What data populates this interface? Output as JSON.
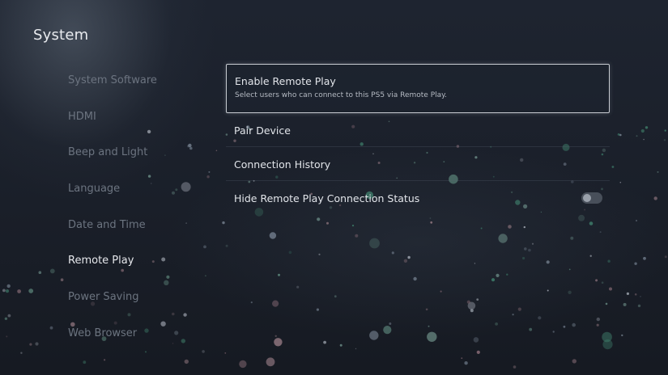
{
  "header": {
    "title": "System"
  },
  "sidebar": {
    "items": [
      {
        "label": "System Software",
        "selected": false
      },
      {
        "label": "HDMI",
        "selected": false
      },
      {
        "label": "Beep and Light",
        "selected": false
      },
      {
        "label": "Language",
        "selected": false
      },
      {
        "label": "Date and Time",
        "selected": false
      },
      {
        "label": "Remote Play",
        "selected": true
      },
      {
        "label": "Power Saving",
        "selected": false
      },
      {
        "label": "Web Browser",
        "selected": false
      }
    ]
  },
  "remote_play": {
    "enable": {
      "label": "Enable Remote Play",
      "description": "Select users who can connect to this PS5 via Remote Play."
    },
    "pair_device": {
      "label": "Pair Device"
    },
    "connection_history": {
      "label": "Connection History"
    },
    "hide_status": {
      "label": "Hide Remote Play Connection Status",
      "toggle_on": false,
      "toggle_icon": "toggle-switch-icon"
    }
  },
  "colors": {
    "background": "#1b2029",
    "text_primary": "#e6e8ec",
    "text_dim": "#6c7480",
    "focus_border": "#c8ccd2"
  }
}
